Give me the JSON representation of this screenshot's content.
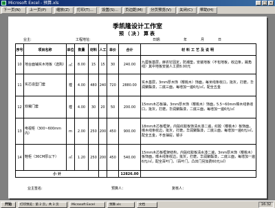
{
  "window": {
    "title": "Microsoft Excel - 预算.xls"
  },
  "toolbar": {
    "buttons": [
      "下一页(N)",
      "上一页(P)",
      "缩放(Z)",
      "打印(T)...",
      "设置(S)...",
      "页边距(M)",
      "分页预览(V)",
      "关闭(C)",
      "帮助(H)"
    ]
  },
  "document": {
    "title": "季凯隆设计工作室",
    "subtitle": "预（决）算表",
    "customer_label": "业主:",
    "project_label": "工程地址:",
    "date_label": "日期:",
    "date_year": "年",
    "date_month": "月",
    "date_day": "日",
    "headers": [
      "序号",
      "项目名称",
      "单位",
      "数量",
      "材料",
      "人工",
      "单价",
      "合计",
      "材料工艺及说明"
    ],
    "rows": [
      {
        "no": "10",
        "name": "地台面铺实木地板（选购）",
        "unit": "㎡",
        "qty": "8.00",
        "mat": "15",
        "labor": "15",
        "price": "30",
        "total": "240.00",
        "desc": "九厘板基层，麻农钉固定，防潮垫，安装地板（不包地板，收边条，踢角线）其中地板安装人工费8.00元"
      },
      {
        "no": "11",
        "name": "实芯造型门套",
        "unit": "樘",
        "qty": "4.00",
        "mat": "480",
        "labor": "240",
        "price": "720",
        "total": "2880.00",
        "desc": "实木基层，3mm厚木饰（樱桃木）饰面，每米线条收口，批灰，打磨，华润聚酯漆，二底三面，每增加一遍6元/㎡，配全五金"
      },
      {
        "no": "12",
        "name": "双裁门套",
        "unit": "樘",
        "qty": "4.00",
        "mat": "30",
        "labor": "20",
        "price": "50",
        "total": "200.00",
        "desc": "15mm木芯板抽，3mm厚木饰（樱桃木）饰面，5.5~60mm樟木线条收口，批灰，打磨，华润聚酯漆，二底三面，每增加一遍6元/㎡"
      },
      {
        "no": "13",
        "name": "电视柜（300~600mm内）",
        "unit": "m",
        "qty": "2.00",
        "mat": "250",
        "labor": "200",
        "price": "450",
        "total": "900.00",
        "desc": "18mm木芯板框架，内贴红胶板饰清水漆二遍，红胶（樱桃木）板饰面，樟木线条收边，批灰，打磨，华润聚酯漆，二底三面，每增加一遍6元/㎡，配全五金，不含抽屉，镜子"
      },
      {
        "no": "14",
        "name": "鞋柜（36CM厚以下）",
        "unit": "㎡",
        "qty": "1.20",
        "mat": "250",
        "labor": "200",
        "price": "450",
        "total": "540.00",
        "desc": "15mm木芯板框架结构，内贴红胶板清水漆二遍，3mm厚木饰（樱桃木）板饰面，樟木线条收边，批灰，打磨，华润聚酯漆，二底三面，每增加一遍6元/㎡，配全百叶门，（百叶门，凸凹门另加费60元/㎡）"
      }
    ],
    "total_label": "小 计",
    "total_value": "12826.00",
    "footer_left": "业主签名:",
    "footer_mid": "预算人：",
    "footer_right": "复核人："
  },
  "statusbar": {
    "preview": "打印预览：第 2 页，共 3 页",
    "start": "开始",
    "tasks": [
      "Microsoft Excel",
      "预算.xls",
      "文档"
    ],
    "clock": "16:32"
  },
  "colors": {
    "titlebar": "#0a246a",
    "chrome": "#d4d0c8",
    "workspace": "#808080"
  }
}
